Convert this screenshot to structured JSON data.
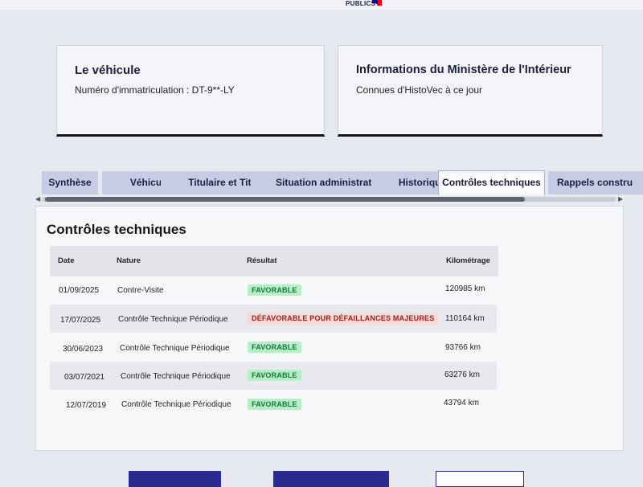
{
  "brand": {
    "label": "PUBLICS+"
  },
  "vehicle_card": {
    "title": "Le véhicule",
    "plate_label": "Numéro d'immatriculation : DT-9**-LY"
  },
  "ministry_card": {
    "title": "Informations du Ministère de l'Intérieur",
    "subtitle": "Connues d'HistoVec à ce jour"
  },
  "tabs": [
    {
      "label": "Synthèse",
      "active": false
    },
    {
      "label": "Véhicule",
      "active": false
    },
    {
      "label": "Titulaire et Titre",
      "active": false
    },
    {
      "label": "Situation administrative",
      "active": false
    },
    {
      "label": "Historique",
      "active": false
    },
    {
      "label": "Contrôles techniques",
      "active": true
    },
    {
      "label": "Rappels constru",
      "active": false
    }
  ],
  "section": {
    "title": "Contrôles techniques",
    "columns": [
      "Date",
      "Nature",
      "Résultat",
      "Kilométrage"
    ],
    "rows": [
      {
        "date": "01/09/2025",
        "nature": "Contre-Visite",
        "result": "FAVORABLE",
        "result_status": "ok",
        "km": "120985 km"
      },
      {
        "date": "17/07/2025",
        "nature": "Contrôle Technique Périodique",
        "result": "DÉFAVORABLE POUR DÉFAILLANCES MAJEURES",
        "result_status": "bad",
        "km": "110164 km"
      },
      {
        "date": "30/06/2023",
        "nature": "Contrôle Technique Périodique",
        "result": "FAVORABLE",
        "result_status": "ok",
        "km": "93766 km"
      },
      {
        "date": "03/07/2021",
        "nature": "Contrôle Technique Périodique",
        "result": "FAVORABLE",
        "result_status": "ok",
        "km": "63276 km"
      },
      {
        "date": "12/07/2019",
        "nature": "Contrôle Technique Périodique",
        "result": "FAVORABLE",
        "result_status": "ok",
        "km": "43794 km"
      }
    ]
  },
  "colors": {
    "tab_bg": "#c6cbe6",
    "favorable_bg": "#b6eec6",
    "favorable_text": "#18753c",
    "defavorable_bg": "#f9d9d6",
    "defavorable_text": "#9b1e1e",
    "primary": "#2a2a8f"
  },
  "icons": {
    "scroll_left": "triangle-left-icon",
    "scroll_right": "triangle-right-icon"
  }
}
